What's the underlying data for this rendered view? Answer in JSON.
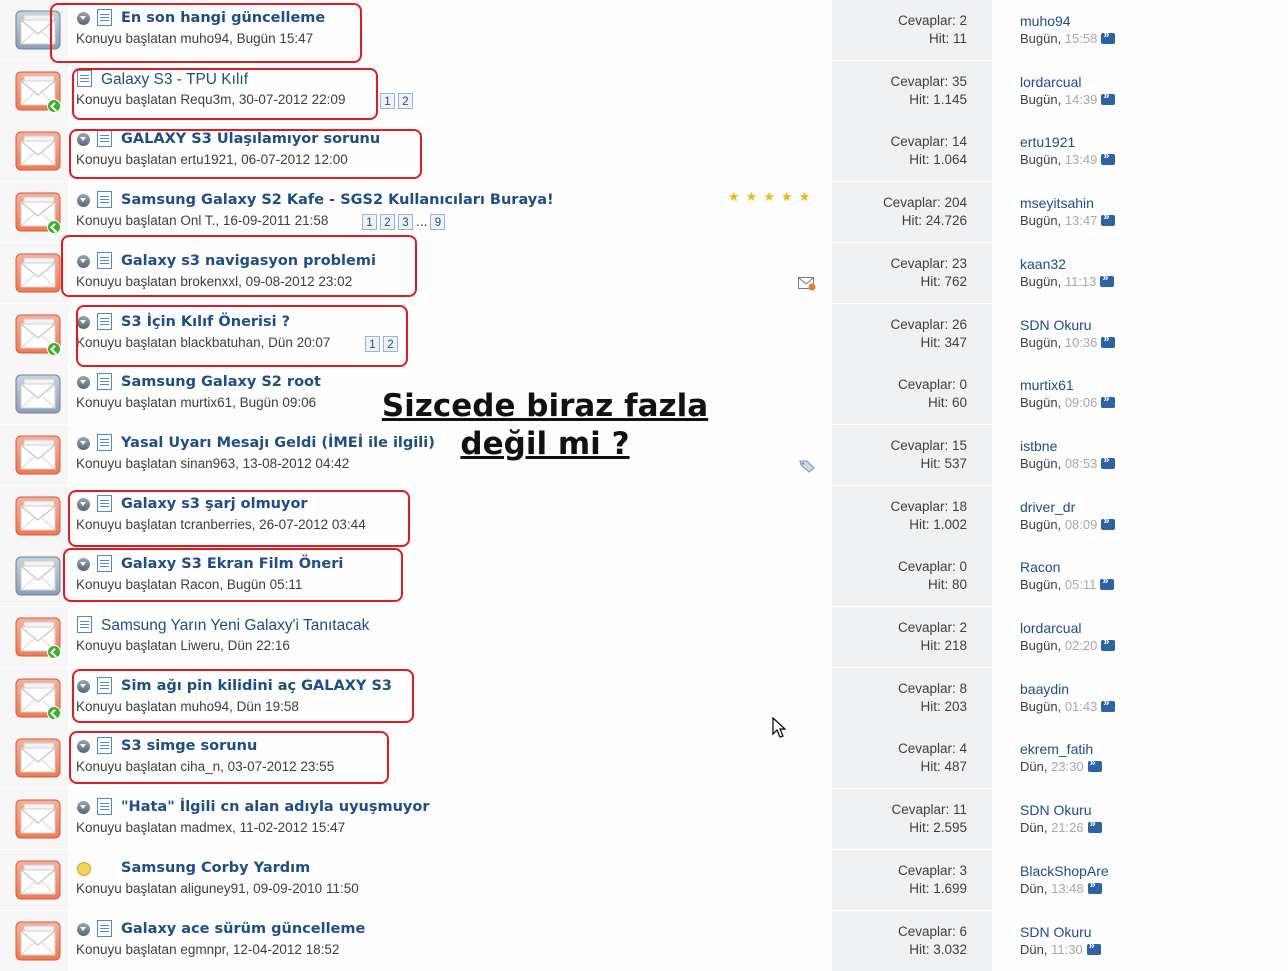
{
  "threads": [
    {
      "title": "En son hangi güncelleme",
      "bold": true,
      "doc": true,
      "prefix": "arrow",
      "starter": "Konuyu başlatan muho94, Bugün 15:47",
      "pages": [],
      "replies": "Cevaplar: 2",
      "hits": "Hit: 11",
      "last_user": "muho94",
      "last_day": "Bugün,",
      "last_time": "15:58",
      "icon": "gray",
      "badge": false
    },
    {
      "title": "Galaxy S3 - TPU Kılıf",
      "bold": false,
      "doc": true,
      "prefix": "none",
      "starter": "Konuyu başlatan Requ3m, 30-07-2012 22:09",
      "pages": [
        "1",
        "2"
      ],
      "replies": "Cevaplar: 35",
      "hits": "Hit: 1.145",
      "last_user": "lordarcual",
      "last_day": "Bugün,",
      "last_time": "14:39",
      "icon": "orange",
      "badge": true
    },
    {
      "title": "GALAXY S3 Ulaşılamıyor sorunu",
      "bold": true,
      "doc": true,
      "prefix": "arrow",
      "starter": "Konuyu başlatan ertu1921, 06-07-2012 12:00",
      "pages": [],
      "replies": "Cevaplar: 14",
      "hits": "Hit: 1.064",
      "last_user": "ertu1921",
      "last_day": "Bugün,",
      "last_time": "13:49",
      "icon": "orange",
      "badge": false
    },
    {
      "title": "Samsung Galaxy S2 Kafe - SGS2 Kullanıcıları Buraya!",
      "bold": true,
      "doc": true,
      "prefix": "arrow",
      "starter": "Konuyu başlatan Onl T., 16-09-2011 21:58",
      "pages": [
        "1",
        "2",
        "3",
        "...",
        "9"
      ],
      "replies": "Cevaplar: 204",
      "hits": "Hit: 24.726",
      "last_user": "mseyitsahin",
      "last_day": "Bugün,",
      "last_time": "13:47",
      "icon": "orange",
      "badge": true,
      "stars": true
    },
    {
      "title": "Galaxy s3 navigasyon problemi",
      "bold": true,
      "doc": true,
      "prefix": "arrow",
      "starter": "Konuyu başlatan brokenxxl, 09-08-2012 23:02",
      "pages": [],
      "replies": "Cevaplar: 23",
      "hits": "Hit: 762",
      "last_user": "kaan32",
      "last_day": "Bugün,",
      "last_time": "11:13",
      "icon": "orange",
      "badge": false,
      "mini": "mail"
    },
    {
      "title": "S3 İçin Kılıf Önerisi ?",
      "bold": true,
      "doc": true,
      "prefix": "arrow",
      "starter": "Konuyu başlatan blackbatuhan, Dün 20:07",
      "pages": [
        "1",
        "2"
      ],
      "replies": "Cevaplar: 26",
      "hits": "Hit: 347",
      "last_user": "SDN Okuru",
      "last_day": "Bugün,",
      "last_time": "10:36",
      "icon": "orange",
      "badge": true
    },
    {
      "title": "Samsung Galaxy S2 root",
      "bold": true,
      "doc": true,
      "prefix": "arrow",
      "starter": "Konuyu başlatan murtix61, Bugün 09:06",
      "pages": [],
      "replies": "Cevaplar: 0",
      "hits": "Hit: 60",
      "last_user": "murtix61",
      "last_day": "Bugün,",
      "last_time": "09:06",
      "icon": "gray",
      "badge": false
    },
    {
      "title": "Yasal Uyarı Mesajı Geldi (İMEİ ile ilgili)",
      "bold": true,
      "doc": true,
      "prefix": "arrow",
      "starter": "Konuyu başlatan sinan963, 13-08-2012 04:42",
      "pages": [],
      "replies": "Cevaplar: 15",
      "hits": "Hit: 537",
      "last_user": "istbne",
      "last_day": "Bugün,",
      "last_time": "08:53",
      "icon": "orange",
      "badge": false,
      "mini": "tag"
    },
    {
      "title": "Galaxy s3 şarj olmuyor",
      "bold": true,
      "doc": true,
      "prefix": "arrow",
      "starter": "Konuyu başlatan tcranberries, 26-07-2012 03:44",
      "pages": [],
      "replies": "Cevaplar: 18",
      "hits": "Hit: 1.002",
      "last_user": "driver_dr",
      "last_day": "Bugün,",
      "last_time": "08:09",
      "icon": "orange",
      "badge": false
    },
    {
      "title": "Galaxy S3 Ekran Film Öneri",
      "bold": true,
      "doc": true,
      "prefix": "arrow",
      "starter": "Konuyu başlatan Racon, Bugün 05:11",
      "pages": [],
      "replies": "Cevaplar: 0",
      "hits": "Hit: 80",
      "last_user": "Racon",
      "last_day": "Bugün,",
      "last_time": "05:11",
      "icon": "gray",
      "badge": false
    },
    {
      "title": "Samsung Yarın Yeni Galaxy'i Tanıtacak",
      "bold": false,
      "doc": true,
      "prefix": "none",
      "starter": "Konuyu başlatan Liweru, Dün 22:16",
      "pages": [],
      "replies": "Cevaplar: 2",
      "hits": "Hit: 218",
      "last_user": "lordarcual",
      "last_day": "Bugün,",
      "last_time": "02:20",
      "icon": "orange",
      "badge": true
    },
    {
      "title": "Sim ağı pin kilidini aç GALAXY S3",
      "bold": true,
      "doc": true,
      "prefix": "arrow",
      "starter": "Konuyu başlatan muho94, Dün 19:58",
      "pages": [],
      "replies": "Cevaplar: 8",
      "hits": "Hit: 203",
      "last_user": "baaydin",
      "last_day": "Bugün,",
      "last_time": "01:43",
      "icon": "orange",
      "badge": true
    },
    {
      "title": "S3 simge sorunu",
      "bold": true,
      "doc": true,
      "prefix": "arrow",
      "starter": "Konuyu başlatan ciha_n, 03-07-2012 23:55",
      "pages": [],
      "replies": "Cevaplar: 4",
      "hits": "Hit: 487",
      "last_user": "ekrem_fatih",
      "last_day": "Dün,",
      "last_time": "23:30",
      "icon": "orange",
      "badge": false
    },
    {
      "title": "\"Hata\" İlgili cn alan adıyla uyuşmuyor",
      "bold": true,
      "doc": true,
      "prefix": "arrow",
      "starter": "Konuyu başlatan madmex, 11-02-2012 15:47",
      "pages": [],
      "replies": "Cevaplar: 11",
      "hits": "Hit: 2.595",
      "last_user": "SDN Okuru",
      "last_day": "Dün,",
      "last_time": "21:26",
      "icon": "orange",
      "badge": false
    },
    {
      "title": "Samsung Corby Yardım",
      "bold": true,
      "doc": false,
      "prefix": "smile",
      "starter": "Konuyu başlatan aliguney91, 09-09-2010 11:50",
      "pages": [],
      "replies": "Cevaplar: 3",
      "hits": "Hit: 1.699",
      "last_user": "BlackShopAre",
      "last_day": "Dün,",
      "last_time": "13:48",
      "icon": "orange",
      "badge": false
    },
    {
      "title": "Galaxy ace sürüm güncelleme",
      "bold": true,
      "doc": true,
      "prefix": "arrow",
      "starter": "Konuyu başlatan egmnpr, 12-04-2012 18:52",
      "pages": [],
      "replies": "Cevaplar: 6",
      "hits": "Hit: 3.032",
      "last_user": "SDN Okuru",
      "last_day": "Dün,",
      "last_time": "11:30",
      "icon": "orange",
      "badge": false
    }
  ],
  "overlay": {
    "line1": "Sizcede biraz fazla",
    "line2": "değil mi ?"
  },
  "colors": {
    "highlight": "#e11b22",
    "link": "#1f4e82",
    "orange_envelope": "#f07a55",
    "gray_envelope": "#8d9fb4"
  }
}
